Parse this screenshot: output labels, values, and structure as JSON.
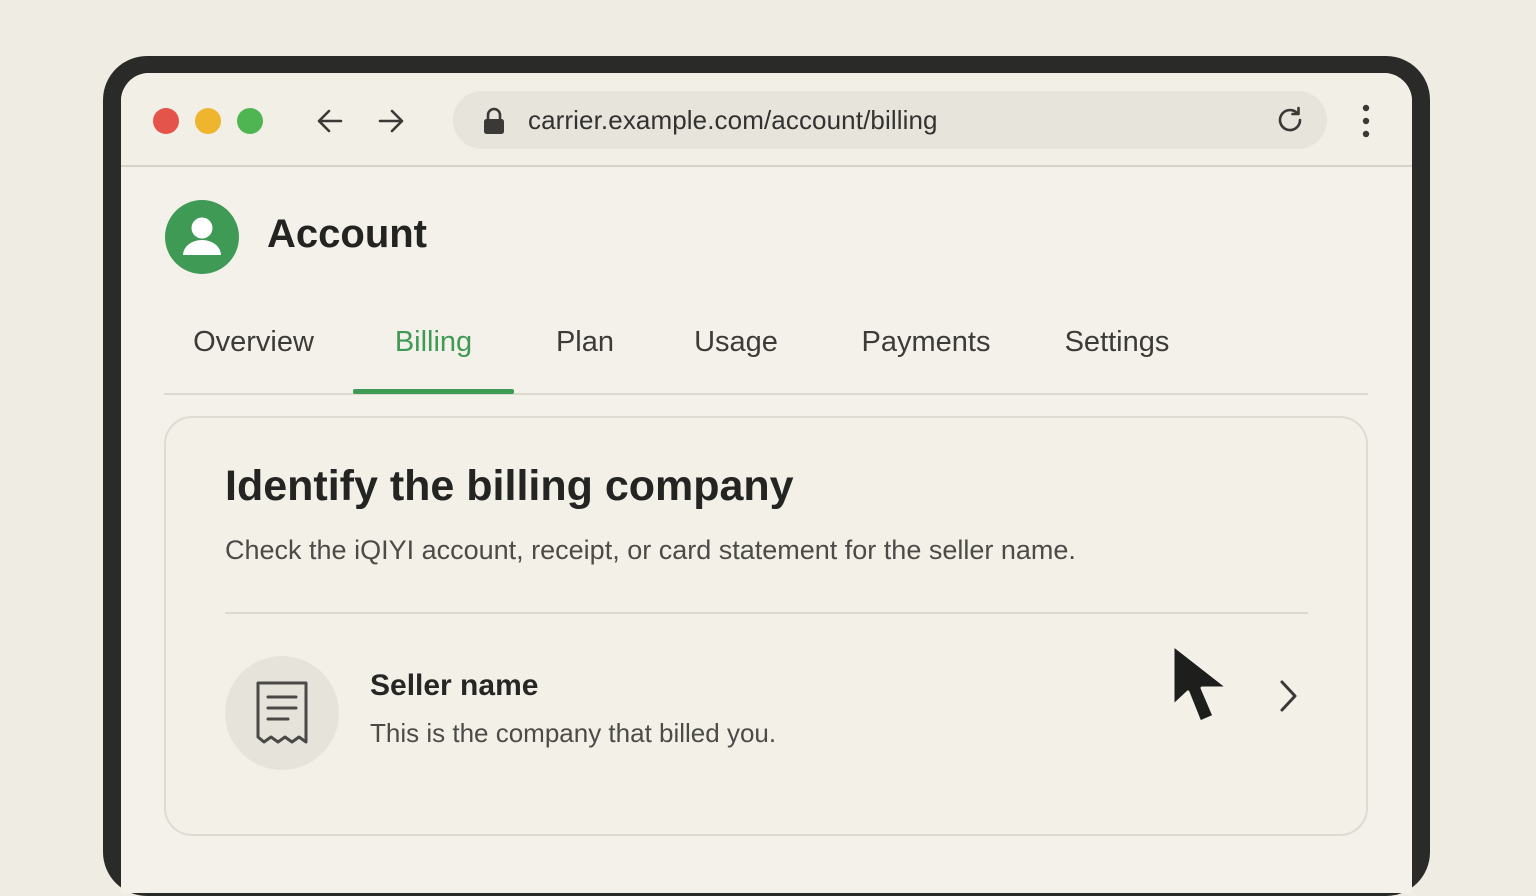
{
  "browser": {
    "url": "carrier.example.com/account/billing",
    "icons": {
      "back": "arrow-left-icon",
      "forward": "arrow-right-icon",
      "lock": "lock-icon",
      "reload": "reload-icon",
      "menu": "vertical-dots-icon"
    }
  },
  "header": {
    "title": "Account",
    "avatar_icon": "user-icon"
  },
  "tabs": [
    {
      "label": "Overview",
      "active": false
    },
    {
      "label": "Billing",
      "active": true
    },
    {
      "label": "Plan",
      "active": false
    },
    {
      "label": "Usage",
      "active": false
    },
    {
      "label": "Payments",
      "active": false
    },
    {
      "label": "Settings",
      "active": false
    }
  ],
  "card": {
    "title": "Identify the billing company",
    "subtitle": "Check the iQIYI account, receipt, or card statement for the seller name.",
    "row": {
      "title": "Seller name",
      "subtitle": "This is the company that billed you.",
      "icon": "receipt-icon"
    }
  },
  "colors": {
    "accent": "#3f9a55",
    "traffic_red": "#e5544a",
    "traffic_yellow": "#efb52f",
    "traffic_green": "#4fb552"
  }
}
